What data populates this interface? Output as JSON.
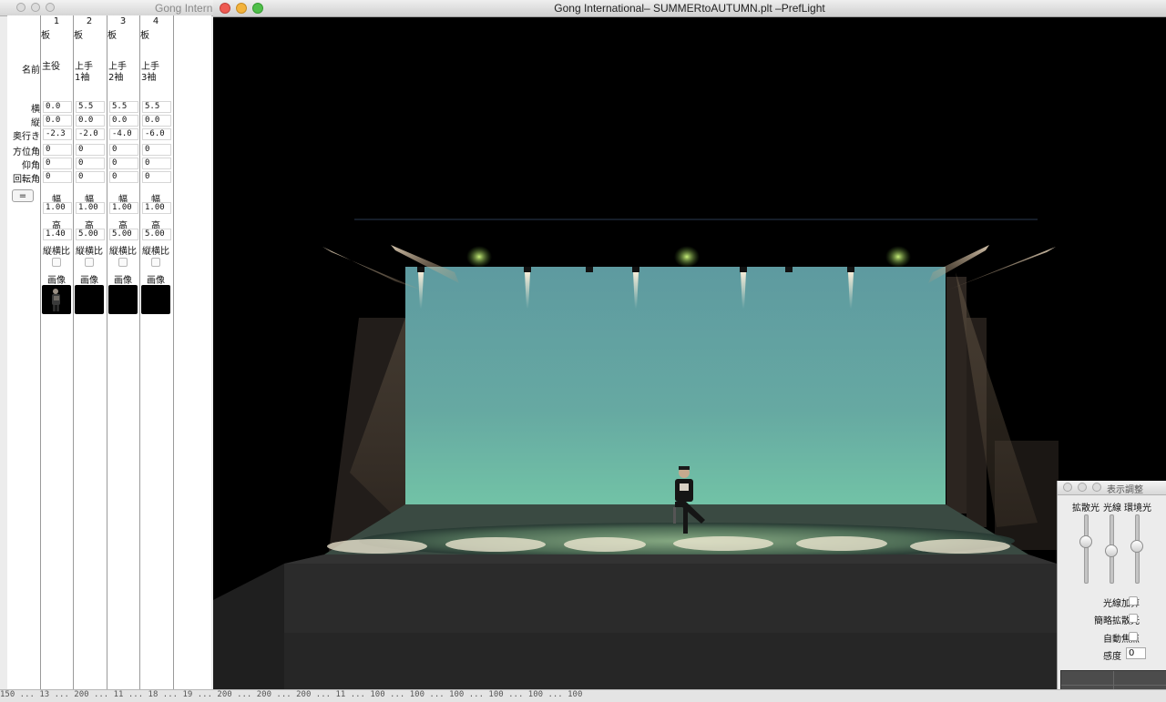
{
  "left_window": {
    "title": "Gong Intern",
    "row_labels": {
      "name": "名前",
      "x": "横",
      "y": "縦",
      "depth": "奥行き",
      "azimuth": "方位角",
      "elevation": "仰角",
      "rotation": "回転角"
    },
    "equal_button": "=",
    "sub_labels": {
      "width": "幅",
      "height": "高",
      "aspect": "縦横比",
      "image": "画像"
    },
    "columns": [
      {
        "num": "1",
        "type": "板",
        "name_line1": "主役",
        "name_line2": "",
        "x": "0.0",
        "y": "0.0",
        "depth": "-2.3",
        "azimuth": "0",
        "elevation": "0",
        "rotation": "0",
        "width": "1.00",
        "height": "1.40"
      },
      {
        "num": "2",
        "type": "板",
        "name_line1": "上手",
        "name_line2": "1袖",
        "x": "5.5",
        "y": "0.0",
        "depth": "-2.0",
        "azimuth": "0",
        "elevation": "0",
        "rotation": "0",
        "width": "1.00",
        "height": "5.00"
      },
      {
        "num": "3",
        "type": "板",
        "name_line1": "上手",
        "name_line2": "2袖",
        "x": "5.5",
        "y": "0.0",
        "depth": "-4.0",
        "azimuth": "0",
        "elevation": "0",
        "rotation": "0",
        "width": "1.00",
        "height": "5.00"
      },
      {
        "num": "4",
        "type": "板",
        "name_line1": "上手",
        "name_line2": "3袖",
        "x": "5.5",
        "y": "0.0",
        "depth": "-6.0",
        "azimuth": "0",
        "elevation": "0",
        "rotation": "0",
        "width": "1.00",
        "height": "5.00"
      }
    ]
  },
  "main_window": {
    "title": "Gong International– SUMMERtoAUTUMN.plt –PrefLight"
  },
  "adjust_panel": {
    "title": "表示調整",
    "slider_labels": [
      "拡散光",
      "光線",
      "環境光"
    ],
    "slider_levels": [
      0.62,
      0.45,
      0.54
    ],
    "options": [
      {
        "label": "光線加算",
        "checked": false
      },
      {
        "label": "簡略拡散光",
        "checked": false
      },
      {
        "label": "自動焦点",
        "checked": false
      }
    ],
    "sensitivity_label": "感度",
    "sensitivity_value": "0"
  },
  "scrollbar_text": "150 ... 13 ... 200 ... 11 ... 18 ... 19 ... 200 ... 200 ... 200 ... 11 ... 100 ... 100 ... 100 ... 100 ... 100 ... 100"
}
